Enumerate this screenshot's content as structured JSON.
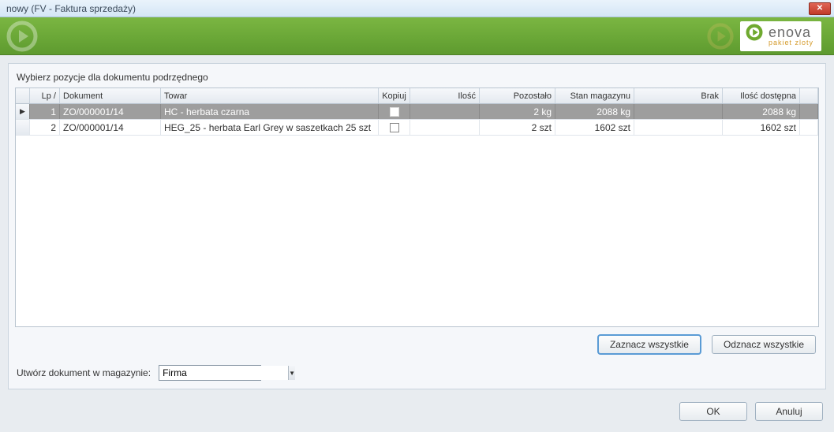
{
  "window": {
    "title": "nowy (FV - Faktura sprzedaży)"
  },
  "logo": {
    "brand": "enova",
    "sub": "pakiet zloty"
  },
  "instruction": "Wybierz pozycje dla dokumentu podrzędnego",
  "columns": {
    "lp": "Lp /",
    "dokument": "Dokument",
    "towar": "Towar",
    "kopiuj": "Kopiuj",
    "ilosc": "Ilość",
    "pozostalo": "Pozostało",
    "stan": "Stan magazynu",
    "brak": "Brak",
    "dostepna": "Ilość dostępna"
  },
  "rows": [
    {
      "lp": "1",
      "dokument": "ZO/000001/14",
      "towar": "HC - herbata czarna",
      "kopiuj": false,
      "ilosc": "",
      "pozostalo": "2 kg",
      "stan": "2088 kg",
      "brak": "",
      "dostepna": "2088 kg",
      "selected": true
    },
    {
      "lp": "2",
      "dokument": "ZO/000001/14",
      "towar": "HEG_25 - herbata Earl Grey w saszetkach 25 szt",
      "kopiuj": false,
      "ilosc": "",
      "pozostalo": "2 szt",
      "stan": "1602 szt",
      "brak": "",
      "dostepna": "1602 szt",
      "selected": false
    }
  ],
  "buttons": {
    "select_all": "Zaznacz wszystkie",
    "deselect_all": "Odznacz wszystkie",
    "ok": "OK",
    "cancel": "Anuluj"
  },
  "warehouse": {
    "label": "Utwórz dokument w magazynie:",
    "value": "Firma"
  }
}
